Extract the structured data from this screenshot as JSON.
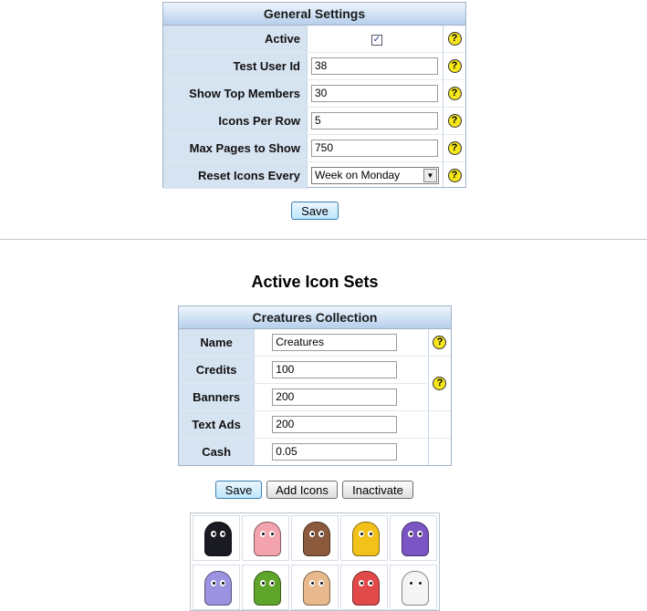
{
  "general_settings": {
    "title": "General Settings",
    "rows": [
      {
        "label": "Active",
        "type": "checkbox",
        "checked": true
      },
      {
        "label": "Test User Id",
        "type": "text",
        "value": "38"
      },
      {
        "label": "Show Top Members",
        "type": "text",
        "value": "30"
      },
      {
        "label": "Icons Per Row",
        "type": "text",
        "value": "5"
      },
      {
        "label": "Max Pages to Show",
        "type": "text",
        "value": "750"
      },
      {
        "label": "Reset Icons Every",
        "type": "select",
        "value": "Week on Monday"
      }
    ],
    "help_glyph": "?",
    "save_label": "Save"
  },
  "active_icon_sets": {
    "title": "Active Icon Sets",
    "collection": {
      "title": "Creatures Collection",
      "rows": [
        {
          "label": "Name",
          "value": "Creatures"
        },
        {
          "label": "Credits",
          "value": "100"
        },
        {
          "label": "Banners",
          "value": "200"
        },
        {
          "label": "Text Ads",
          "value": "200"
        },
        {
          "label": "Cash",
          "value": "0.05"
        }
      ]
    },
    "buttons": {
      "save": "Save",
      "add_icons": "Add Icons",
      "inactivate": "Inactivate"
    },
    "icons": [
      {
        "name": "black-creature-icon",
        "color": "#1a1a22"
      },
      {
        "name": "pink-creature-icon",
        "color": "#f2a3ae"
      },
      {
        "name": "brown-creature-icon",
        "color": "#8b5a3c"
      },
      {
        "name": "yellow-creature-icon",
        "color": "#f2c21b"
      },
      {
        "name": "purple-creature-icon",
        "color": "#7b55c4"
      },
      {
        "name": "lilac-creature-icon",
        "color": "#9b93e0"
      },
      {
        "name": "green-creature-icon",
        "color": "#5fa52a"
      },
      {
        "name": "tan-creature-icon",
        "color": "#e7b98c"
      },
      {
        "name": "red-creature-icon",
        "color": "#e24a4a"
      },
      {
        "name": "white-creature-icon",
        "color": "#f4f4f4"
      }
    ]
  }
}
